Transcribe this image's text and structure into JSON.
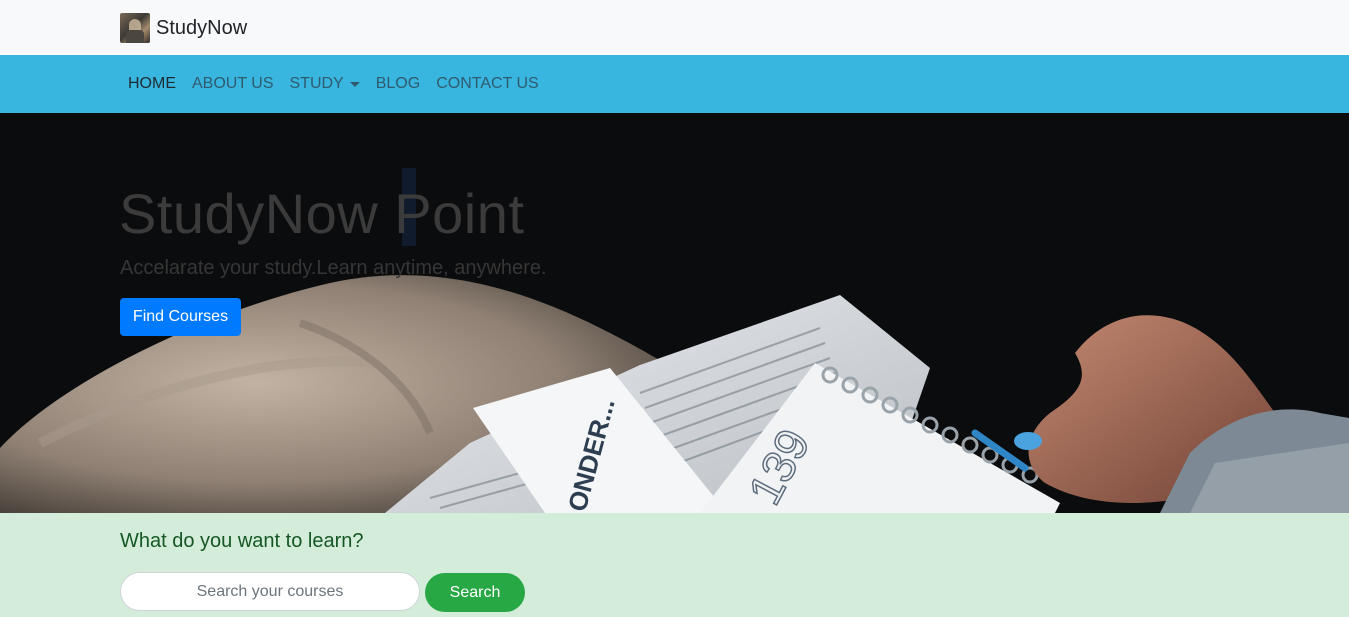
{
  "brand": {
    "name": "StudyNow",
    "logo_icon": "profile-photo-icon"
  },
  "nav": {
    "items": [
      {
        "label": "HOME",
        "active": true
      },
      {
        "label": "ABOUT US"
      },
      {
        "label": "STUDY",
        "dropdown": true
      },
      {
        "label": "BLOG"
      },
      {
        "label": "CONTACT US"
      }
    ]
  },
  "hero": {
    "title": "StudyNow Point",
    "subtitle": "Accelarate your study.Learn anytime, anywhere.",
    "button_label": "Find Courses",
    "notebook_text": "ONDER...",
    "notebook_number": "139"
  },
  "search": {
    "heading": "What do you want to learn?",
    "placeholder": "Search your courses",
    "value": "",
    "button_label": "Search"
  },
  "colors": {
    "topbar_bg": "#f8f9fa",
    "navbar_bg": "#39b6df",
    "hero_bg": "#0b0c0e",
    "primary_button": "#007bff",
    "search_section_bg": "#d4edda",
    "search_button": "#28a745"
  }
}
